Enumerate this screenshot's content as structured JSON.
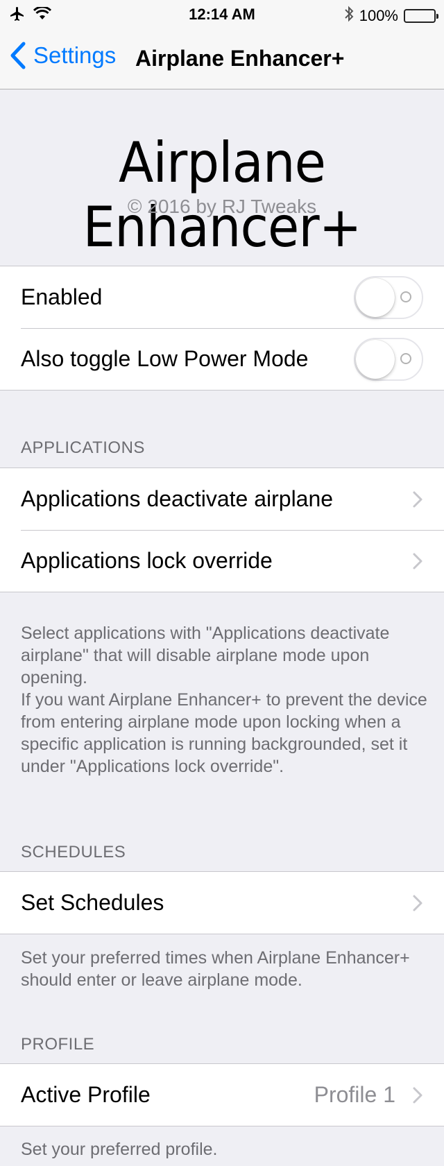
{
  "status": {
    "time": "12:14 AM",
    "battery": "100%",
    "battery_level": 1.0
  },
  "nav": {
    "back_label": "Settings",
    "title": "Airplane Enhancer+"
  },
  "header": {
    "title": "Airplane Enhancer+",
    "copyright": "© 2016 by RJ Tweaks"
  },
  "toggles": {
    "enabled_label": "Enabled",
    "enabled": false,
    "low_power_label": "Also toggle Low Power Mode",
    "low_power": false
  },
  "applications": {
    "header": "APPLICATIONS",
    "items": [
      "Applications deactivate airplane",
      "Applications lock override"
    ],
    "footer": "Select applications with \"Applications deactivate airplane\" that will disable airplane mode upon opening.\nIf you want Airplane Enhancer+ to prevent the device from entering airplane mode upon locking when a specific application is running backgrounded, set it under \"Applications lock override\"."
  },
  "schedules": {
    "header": "SCHEDULES",
    "item": "Set Schedules",
    "footer": "Set your preferred times when Airplane Enhancer+ should enter or leave airplane mode."
  },
  "profile": {
    "header": "PROFILE",
    "item": "Active Profile",
    "value": "Profile 1",
    "footer": "Set your preferred profile."
  },
  "colors": {
    "accent": "#007aff",
    "background": "#efeff4",
    "battery": "#ffcc00"
  }
}
